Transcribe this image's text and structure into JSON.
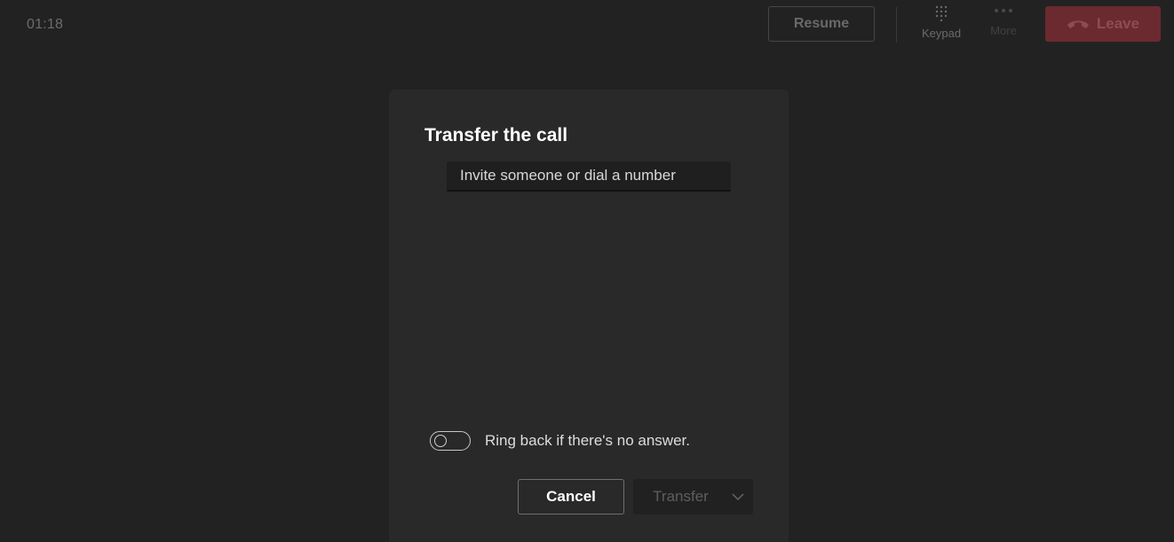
{
  "call": {
    "timer": "01:18"
  },
  "toolbar": {
    "resume_label": "Resume",
    "keypad_label": "Keypad",
    "keypad_icon": "dialpad-icon",
    "more_label": "More",
    "more_icon": "ellipsis-icon",
    "leave_label": "Leave",
    "leave_icon": "hang-up-icon"
  },
  "dialog": {
    "title": "Transfer the call",
    "invite": {
      "placeholder": "Invite someone or dial a number",
      "value": ""
    },
    "ring_back": {
      "label": "Ring back if there's no answer.",
      "enabled": false
    },
    "cancel_label": "Cancel",
    "transfer_label": "Transfer",
    "transfer_chevron_icon": "chevron-down-icon"
  },
  "colors": {
    "background": "#232223",
    "dialog_background": "#292929",
    "leave_button": "#6a2a30"
  }
}
